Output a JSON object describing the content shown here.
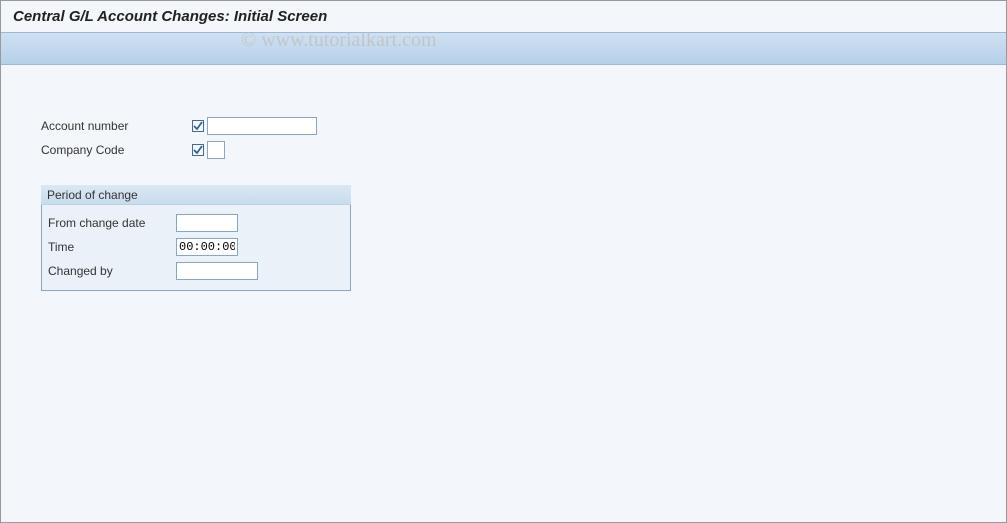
{
  "title": "Central G/L Account Changes: Initial Screen",
  "watermark": "© www.tutorialkart.com",
  "top_fields": {
    "account_number": {
      "label": "Account number",
      "value": "",
      "required": true
    },
    "company_code": {
      "label": "Company Code",
      "value": "",
      "required": true
    }
  },
  "period_group": {
    "title": "Period of change",
    "from_date": {
      "label": "From change date",
      "value": ""
    },
    "time": {
      "label": "Time",
      "value": "00:00:00"
    },
    "changed_by": {
      "label": "Changed by",
      "value": ""
    }
  }
}
